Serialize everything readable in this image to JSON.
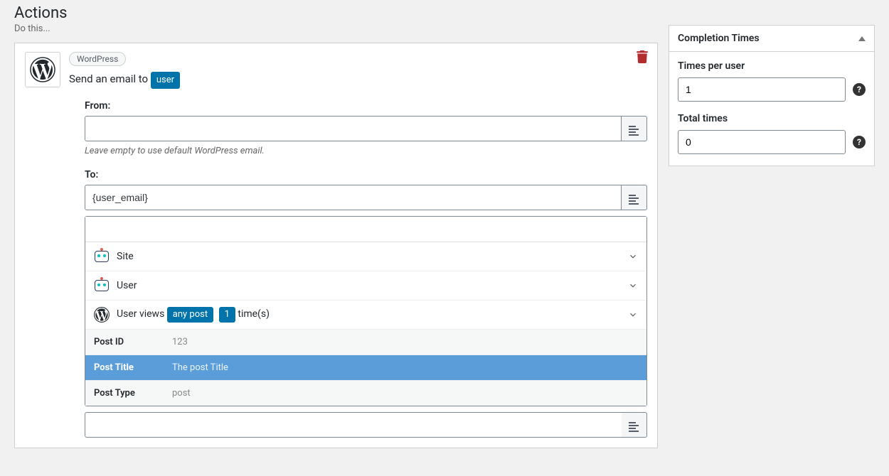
{
  "page": {
    "title": "Actions",
    "subtitle": "Do this..."
  },
  "action": {
    "integration_chip": "WordPress",
    "sentence_prefix": "Send an email to ",
    "sentence_pill": "user"
  },
  "fields": {
    "from": {
      "label": "From:",
      "value": "",
      "hint": "Leave empty to use default WordPress email."
    },
    "to": {
      "label": "To:",
      "value": "{user_email}"
    }
  },
  "tag_picker": {
    "search_value": "",
    "categories": {
      "site": "Site",
      "user": "User",
      "trigger_prefix": "User views ",
      "trigger_pill1": "any post",
      "trigger_pill2": "1",
      "trigger_suffix": " time(s)"
    },
    "options": [
      {
        "key": "Post ID",
        "val": "123",
        "selected": false
      },
      {
        "key": "Post Title",
        "val": "The post Title",
        "selected": true
      },
      {
        "key": "Post Type",
        "val": "post",
        "selected": false
      }
    ]
  },
  "completion": {
    "panel_title": "Completion Times",
    "times_per_user_label": "Times per user",
    "times_per_user_value": "1",
    "total_times_label": "Total times",
    "total_times_value": "0"
  }
}
